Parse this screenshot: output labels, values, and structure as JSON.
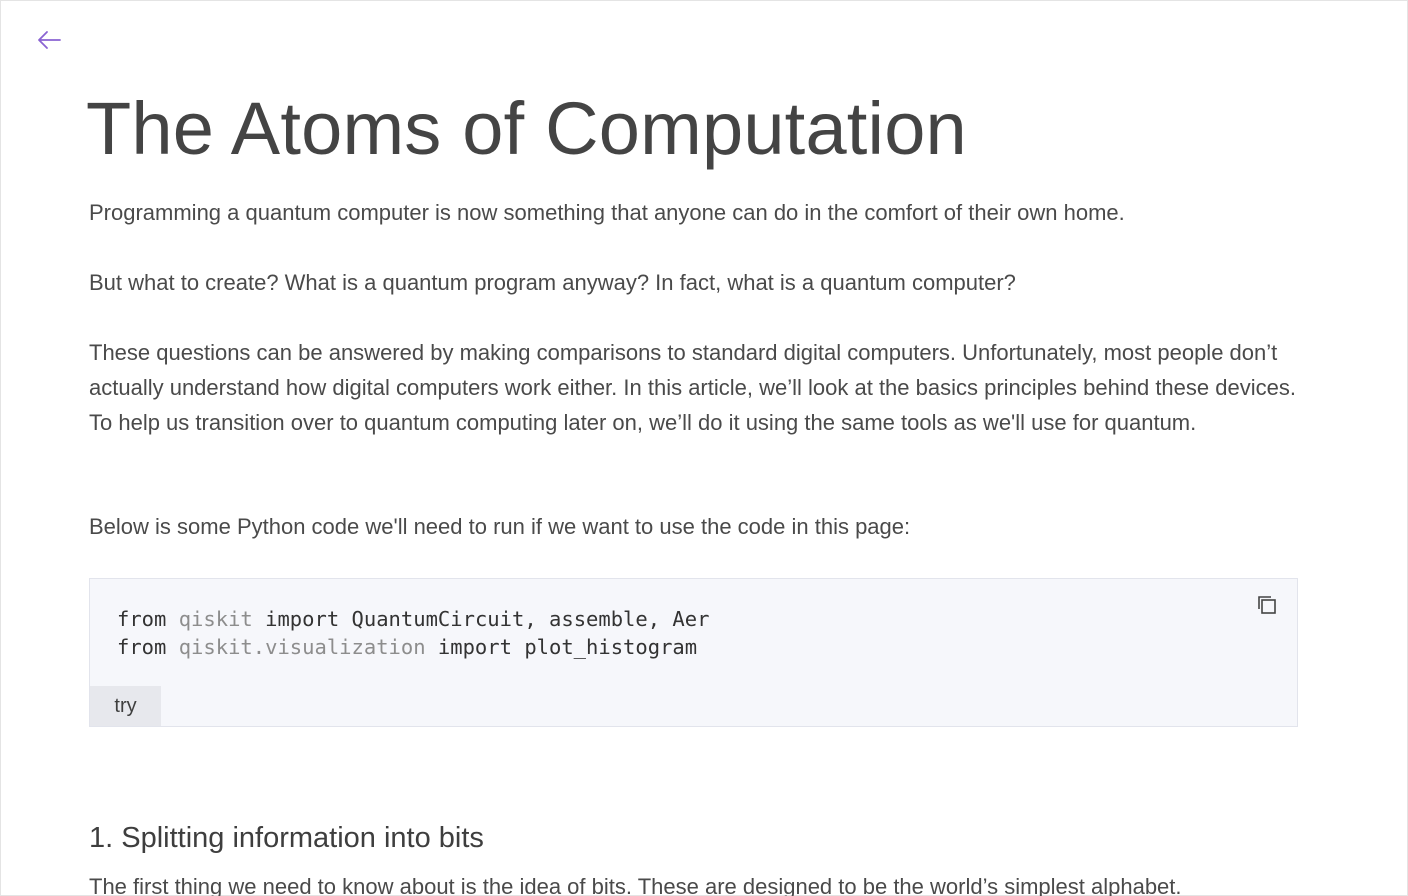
{
  "nav": {
    "back_icon": "arrow-left-icon",
    "accent": "#8a63d2"
  },
  "title": "The Atoms of Computation",
  "paragraphs": {
    "p1": "Programming a quantum computer is now something that anyone can do in the comfort of their own home.",
    "p2": "But what to create? What is a quantum program anyway? In fact, what is a quantum computer?",
    "p3": "These questions can be answered by making comparisons to standard digital computers. Unfortunately, most people don’t actually understand how digital computers work either. In this article, we’ll look at the basics principles behind these devices. To help us transition over to quantum computing later on, we’ll do it using the same tools as we'll use for quantum.",
    "p4": "Below is some Python code we'll need to run if we want to use the code in this page:",
    "p5": "The first thing we need to know about is the idea of bits. These are designed to be the world’s simplest alphabet."
  },
  "code": {
    "line1": {
      "kw_from": "from",
      "module": "qiskit",
      "kw_import": "import",
      "names": "QuantumCircuit, assemble, Aer"
    },
    "line2": {
      "kw_from": "from",
      "module": "qiskit.visualization",
      "kw_import": "import",
      "names": "plot_histogram"
    },
    "copy_icon": "copy-icon",
    "try_label": "try"
  },
  "section1": {
    "heading": "1. Splitting information into bits"
  }
}
